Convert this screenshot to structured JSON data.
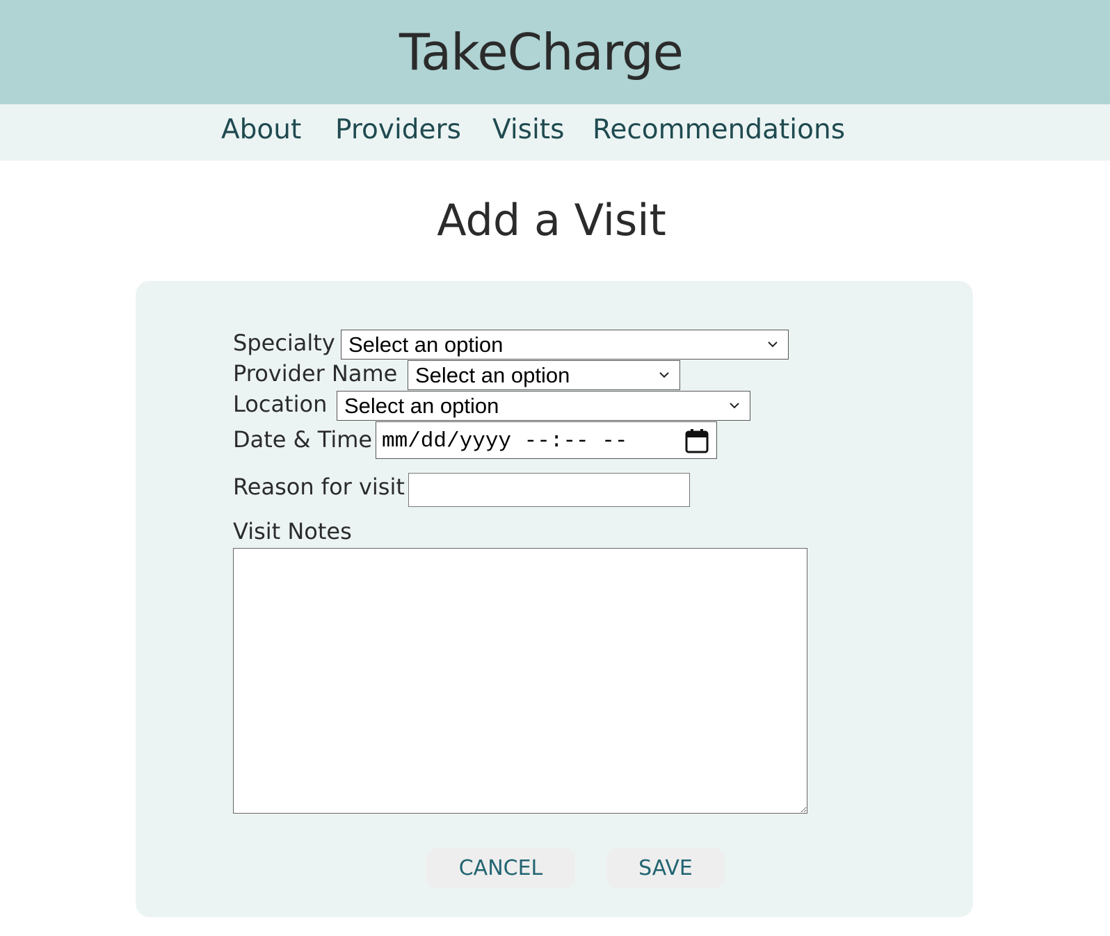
{
  "app": {
    "title": "TakeCharge"
  },
  "nav": {
    "items": [
      {
        "label": "About"
      },
      {
        "label": "Providers"
      },
      {
        "label": "Visits"
      },
      {
        "label": "Recommendations"
      }
    ]
  },
  "page": {
    "title": "Add a Visit"
  },
  "form": {
    "specialty": {
      "label": "Specialty",
      "value": "Select an option"
    },
    "provider_name": {
      "label": "Provider Name",
      "value": "Select an option"
    },
    "location": {
      "label": "Location",
      "value": "Select an option"
    },
    "date_time": {
      "label": "Date & Time",
      "placeholder": "mm/dd/yyyy --:-- --"
    },
    "reason": {
      "label": "Reason for visit",
      "value": ""
    },
    "notes": {
      "label": "Visit Notes",
      "value": ""
    },
    "buttons": {
      "cancel": "CANCEL",
      "save": "SAVE"
    }
  },
  "colors": {
    "header_bg": "#b0d3d3",
    "nav_bg": "#ecf4f3",
    "card_bg": "#ecf4f3",
    "nav_text": "#1f4a50",
    "button_text": "#216471",
    "button_bg": "#eeeeee"
  },
  "icons": {
    "select_arrow": "chevron-down-icon",
    "date_picker": "calendar-icon"
  }
}
